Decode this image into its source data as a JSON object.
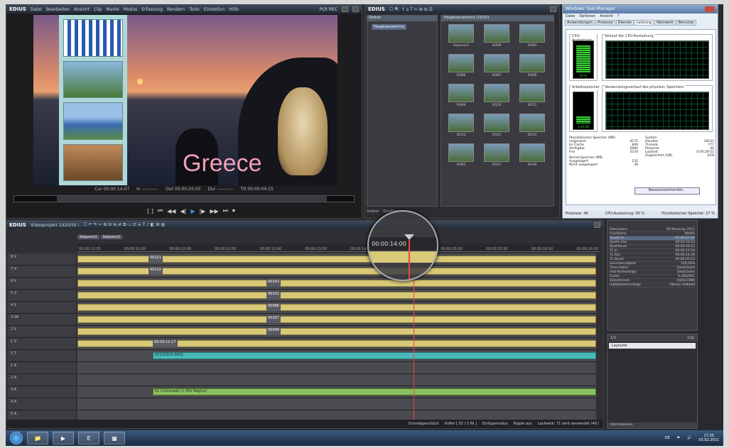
{
  "player": {
    "brand": "EDIUS",
    "menu": [
      "Datei",
      "Bearbeiten",
      "Ansicht",
      "Clip",
      "Marke",
      "Modus",
      "Erfassung",
      "Rendern",
      "Tools",
      "Einstellun",
      "Hilfe"
    ],
    "mode": "PLR REC",
    "overlay_text": "Greece",
    "timecodes": [
      "Cur 00:00:14:07",
      "In --:--:--:--",
      "Out 00:00:25:05",
      "Dur --:--:--:--",
      "Ttl 00:00:04:15"
    ],
    "transport_symbols": [
      "[ ]",
      "⏮",
      "◀◀",
      "◀|",
      "▶",
      "|▶",
      "▶▶",
      "⏭",
      "⏺"
    ]
  },
  "bin": {
    "brand": "EDIUS",
    "tree_header": "Ordner",
    "tree_root": "Hauptverzeichnis",
    "clips_header": "Hauptverzeichnis (15/15)",
    "clip_labels": [
      "Sequence1",
      "00099",
      "00083",
      "00086",
      "00087",
      "00088",
      "00098",
      "00120",
      "00121",
      "00132",
      "00141",
      "00143",
      "00095",
      "00107",
      "00109"
    ],
    "footer": [
      "Ordner",
      "Quellbrowser"
    ]
  },
  "taskmgr": {
    "title": "Windows Task-Manager",
    "menu": [
      "Datei",
      "Optionen",
      "Ansicht",
      "?"
    ],
    "tabs": [
      "Anwendungen",
      "Prozesse",
      "Dienste",
      "Leistung",
      "Netzwerk",
      "Benutzer"
    ],
    "active_tab": "Leistung",
    "cpu_caption": "CPU-Auslastung",
    "cpu_hist_caption": "Verlauf der CPU-Auslastung",
    "cpu_value": "93 %",
    "mem_caption": "Arbeitsspeicher",
    "mem_hist_caption": "Verwendungsverlauf des physikal. Speichers",
    "mem_value": "3,19 GB",
    "phys_header": "Physikalischer Speicher (MB)",
    "phys": [
      [
        "Insgesamt",
        "8172"
      ],
      [
        "Im Cache",
        "849"
      ],
      [
        "Verfügbar",
        "5960"
      ],
      [
        "Frei",
        "5150"
      ]
    ],
    "sys_header": "System",
    "sys": [
      [
        "Handles",
        "19141"
      ],
      [
        "Threads",
        "777"
      ],
      [
        "Prozesse",
        "46"
      ],
      [
        "Laufzeit",
        "0:00:29:51"
      ],
      [
        "Zugesichert (GB)",
        "3/18"
      ]
    ],
    "kernel_header": "Kernel-Speicher (MB)",
    "kernel": [
      [
        "Ausgelagert",
        "132"
      ],
      [
        "Nicht ausgelagert",
        "39"
      ]
    ],
    "res_button": "Ressourcenmonitor...",
    "status": [
      "Prozesse: 46",
      "CPU-Auslastung: 93 %",
      "Physikalischer Speicher: 27 %"
    ]
  },
  "timeline": {
    "brand": "EDIUS",
    "project": "Videoprojekt 1920/50 i",
    "seq_tabs": [
      "Sequenz1",
      "Sequenz2"
    ],
    "ruler": [
      "00:00:11:25",
      "00:00:11:50",
      "00:00:12:00",
      "00:00:12:50",
      "00:00:13:00",
      "00:00:13:50",
      "00:00:14:00",
      "00:00:14:50",
      "00:00:15:00",
      "00:00:15:50",
      "00:00:16:00",
      "00:00:16:50"
    ],
    "magnifier_tc": "00:00:14:00",
    "tracks": [
      {
        "name": "8 V",
        "clips": [
          {
            "label": "00121",
            "kind": "label"
          },
          {
            "label": "",
            "kind": "yellow"
          }
        ]
      },
      {
        "name": "7 V",
        "clips": [
          {
            "label": "00132",
            "kind": "label"
          },
          {
            "label": "",
            "kind": "yellow"
          }
        ]
      },
      {
        "name": "6 V",
        "clips": [
          {
            "label": "00143",
            "kind": "label"
          },
          {
            "label": "",
            "kind": "yellow"
          }
        ]
      },
      {
        "name": "5 V",
        "clips": [
          {
            "label": "00141",
            "kind": "label"
          },
          {
            "label": "",
            "kind": "yellow"
          }
        ]
      },
      {
        "name": "4 V",
        "clips": [
          {
            "label": "00086",
            "kind": "label"
          },
          {
            "label": "",
            "kind": "yellow"
          }
        ]
      },
      {
        "name": "3 VA",
        "clips": [
          {
            "label": "00107",
            "kind": "label"
          },
          {
            "label": "",
            "kind": "yellow"
          }
        ]
      },
      {
        "name": "2 V",
        "clips": [
          {
            "label": "00099",
            "kind": "label"
          },
          {
            "label": "",
            "kind": "yellow"
          }
        ]
      },
      {
        "name": "1 V",
        "clips": [
          {
            "label": "00:00:11:17",
            "kind": "label"
          },
          {
            "label": "",
            "kind": "yellow"
          }
        ]
      },
      {
        "name": "1 T",
        "clips": [
          {
            "label": "20110315-0001",
            "kind": "teal"
          }
        ]
      },
      {
        "name": "1 A",
        "clips": []
      },
      {
        "name": "2 A",
        "clips": []
      },
      {
        "name": "3 A",
        "clips": [
          {
            "label": "01 Corcovado (+ Elis Regina)",
            "kind": "green"
          }
        ]
      },
      {
        "name": "4 A",
        "clips": []
      },
      {
        "name": "5 A",
        "clips": []
      }
    ],
    "status": [
      "Schreibgeschützt",
      "Puffer [ 55 / 3 fill ]",
      "Einfügemodus",
      "Ripple aus",
      "Laufwerk: 71 wird verwendet (46')"
    ]
  },
  "info": {
    "rows": [
      [
        "Dateiname",
        "PE Reiseclip 2011"
      ],
      [
        "Clip-Name",
        "00091"
      ],
      [
        "Quelle In",
        "00:00:07:08"
      ],
      [
        "Quelle Out",
        "00:00:10:23"
      ],
      [
        "Quelldauer",
        "00:00:03:15"
      ],
      [
        "TL In",
        "00:00:11:14"
      ],
      [
        "TL Out",
        "00:00:14:29"
      ],
      [
        "TL Dauer",
        "00:00:03:15"
      ],
      [
        "Geschwindigkeit",
        "100,00%"
      ],
      [
        "Time-Faktor",
        "Deaktiviert"
      ],
      [
        "Feld-Reihenfolge",
        "Deaktiviert"
      ],
      [
        "Codec",
        "H.264/AVC"
      ],
      [
        "Videoformat",
        "1920x1080"
      ],
      [
        "Halbbildreihenfolge",
        "Oberes Halbbild"
      ]
    ],
    "selected_index": 2
  },
  "layer": {
    "header_left": "1/2",
    "header_right": "Clip",
    "row": "Layouter",
    "footer": "Informationen"
  },
  "taskbar": {
    "tray": "DE",
    "time": "17:35",
    "date": "03.02.2011"
  }
}
